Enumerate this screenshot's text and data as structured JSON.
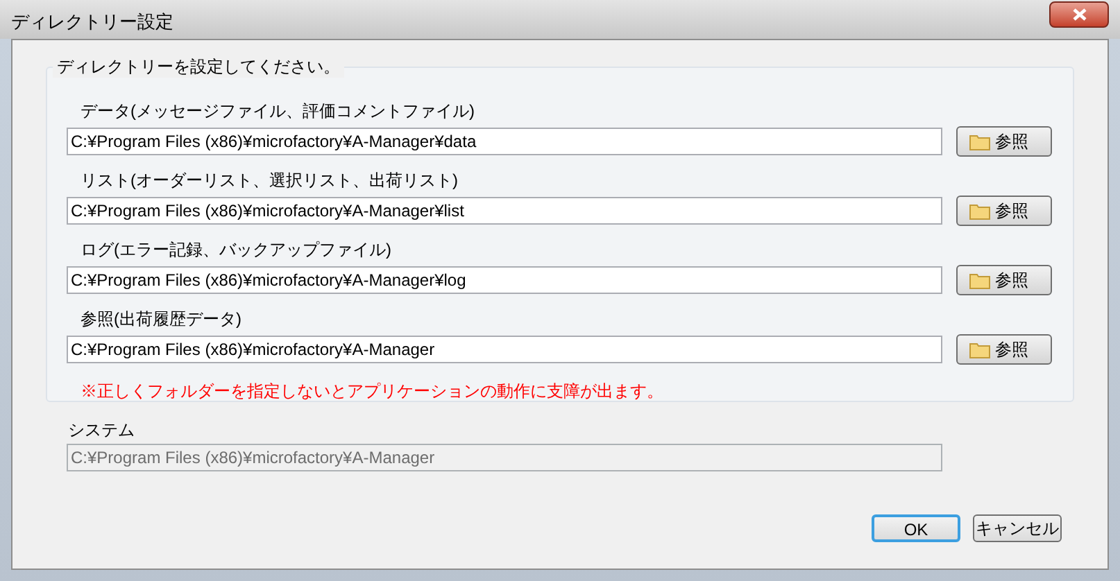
{
  "window": {
    "title": "ディレクトリー設定"
  },
  "group": {
    "legend": "ディレクトリーを設定してください。",
    "directories": [
      {
        "label": "データ(メッセージファイル、評価コメントファイル)",
        "value": "C:¥Program Files (x86)¥microfactory¥A-Manager¥data",
        "button": "参照"
      },
      {
        "label": "リスト(オーダーリスト、選択リスト、出荷リスト)",
        "value": "C:¥Program Files (x86)¥microfactory¥A-Manager¥list",
        "button": "参照"
      },
      {
        "label": "ログ(エラー記録、バックアップファイル)",
        "value": "C:¥Program Files (x86)¥microfactory¥A-Manager¥log",
        "button": "参照"
      },
      {
        "label": "参照(出荷履歴データ)",
        "value": "C:¥Program Files (x86)¥microfactory¥A-Manager",
        "button": "参照"
      }
    ],
    "warning": "※正しくフォルダーを指定しないとアプリケーションの動作に支障が出ます。"
  },
  "system": {
    "label": "システム",
    "value": "C:¥Program Files (x86)¥microfactory¥A-Manager",
    "disabled": true
  },
  "buttons": [
    {
      "label": "OK",
      "default": true
    },
    {
      "label": "キャンセル",
      "default": false
    }
  ]
}
